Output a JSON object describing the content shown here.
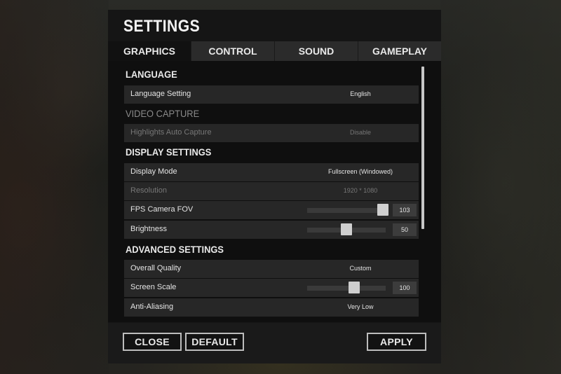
{
  "title": "SETTINGS",
  "tabs": [
    {
      "label": "GRAPHICS",
      "active": true
    },
    {
      "label": "CONTROL",
      "active": false
    },
    {
      "label": "SOUND",
      "active": false
    },
    {
      "label": "GAMEPLAY",
      "active": false
    }
  ],
  "sections": {
    "language": "LANGUAGE",
    "video_capture": "VIDEO CAPTURE",
    "display": "DISPLAY SETTINGS",
    "advanced": "ADVANCED SETTINGS"
  },
  "rows": {
    "language_setting": {
      "label": "Language Setting",
      "value": "English"
    },
    "highlights": {
      "label": "Highlights Auto Capture",
      "value": "Disable"
    },
    "display_mode": {
      "label": "Display Mode",
      "value": "Fullscreen (Windowed)"
    },
    "resolution": {
      "label": "Resolution",
      "value": "1920 * 1080"
    },
    "fov": {
      "label": "FPS Camera FOV",
      "value": "103",
      "level": 0.96
    },
    "brightness": {
      "label": "Brightness",
      "value": "50",
      "level": 0.5
    },
    "overall_quality": {
      "label": "Overall Quality",
      "value": "Custom"
    },
    "screen_scale": {
      "label": "Screen Scale",
      "value": "100",
      "level": 0.6
    },
    "anti_aliasing": {
      "label": "Anti-Aliasing",
      "value": "Very Low"
    }
  },
  "buttons": {
    "close": "CLOSE",
    "default": "DEFAULT",
    "apply": "APPLY"
  },
  "colors": {
    "panel": "#151515",
    "row": "#272727",
    "accent": "#cfcfcf"
  }
}
